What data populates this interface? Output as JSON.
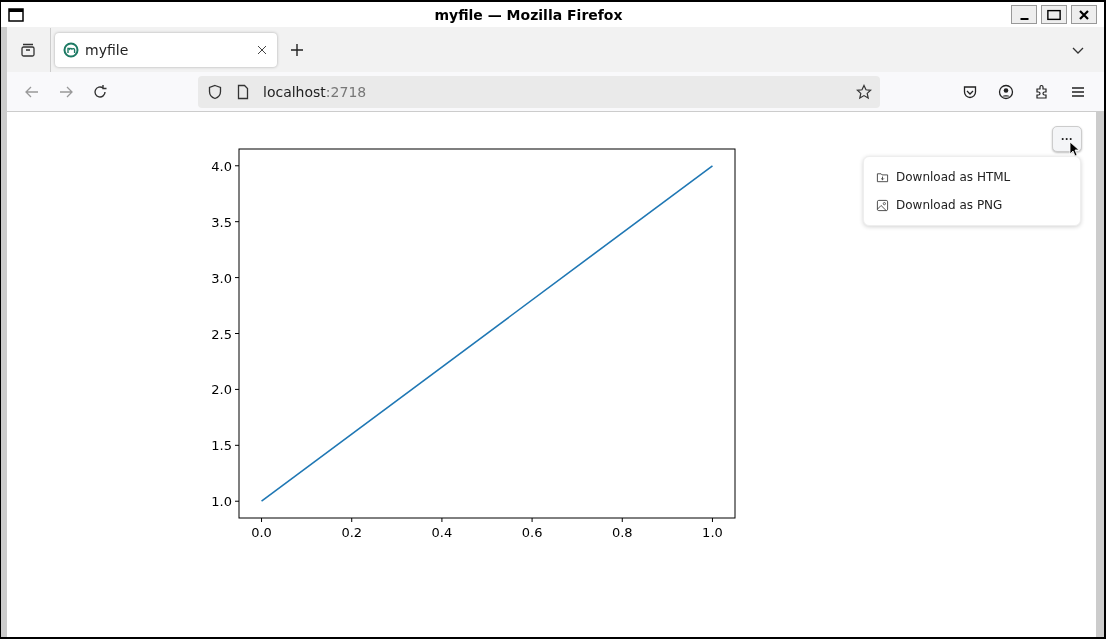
{
  "window": {
    "title": "myfile — Mozilla Firefox"
  },
  "tabs": [
    {
      "label": "myfile",
      "selected": true
    }
  ],
  "address_bar": {
    "host": "localhost",
    "port": ":2718"
  },
  "menu_button": {
    "label": "···"
  },
  "menu": {
    "items": [
      {
        "kind": "html",
        "label": "Download as HTML"
      },
      {
        "kind": "png",
        "label": "Download as PNG"
      }
    ]
  },
  "plot": {
    "chart_data": {
      "type": "line",
      "x": [
        0,
        1
      ],
      "series": [
        {
          "color": "#1f77b4",
          "values": [
            1,
            4
          ]
        }
      ],
      "xlim": [
        -0.05,
        1.05
      ],
      "ylim": [
        0.85,
        4.15
      ],
      "xticks": [
        {
          "value": 0,
          "label": "0.0"
        },
        {
          "value": 0.2,
          "label": "0.2"
        },
        {
          "value": 0.4,
          "label": "0.4"
        },
        {
          "value": 0.6,
          "label": "0.6"
        },
        {
          "value": 0.8,
          "label": "0.8"
        },
        {
          "value": 1,
          "label": "1.0"
        }
      ],
      "yticks": [
        {
          "value": 1,
          "label": "1.0"
        },
        {
          "value": 1.5,
          "label": "1.5"
        },
        {
          "value": 2,
          "label": "2.0"
        },
        {
          "value": 2.5,
          "label": "2.5"
        },
        {
          "value": 3,
          "label": "3.0"
        },
        {
          "value": 3.5,
          "label": "3.5"
        },
        {
          "value": 4,
          "label": "4.0"
        }
      ]
    }
  }
}
